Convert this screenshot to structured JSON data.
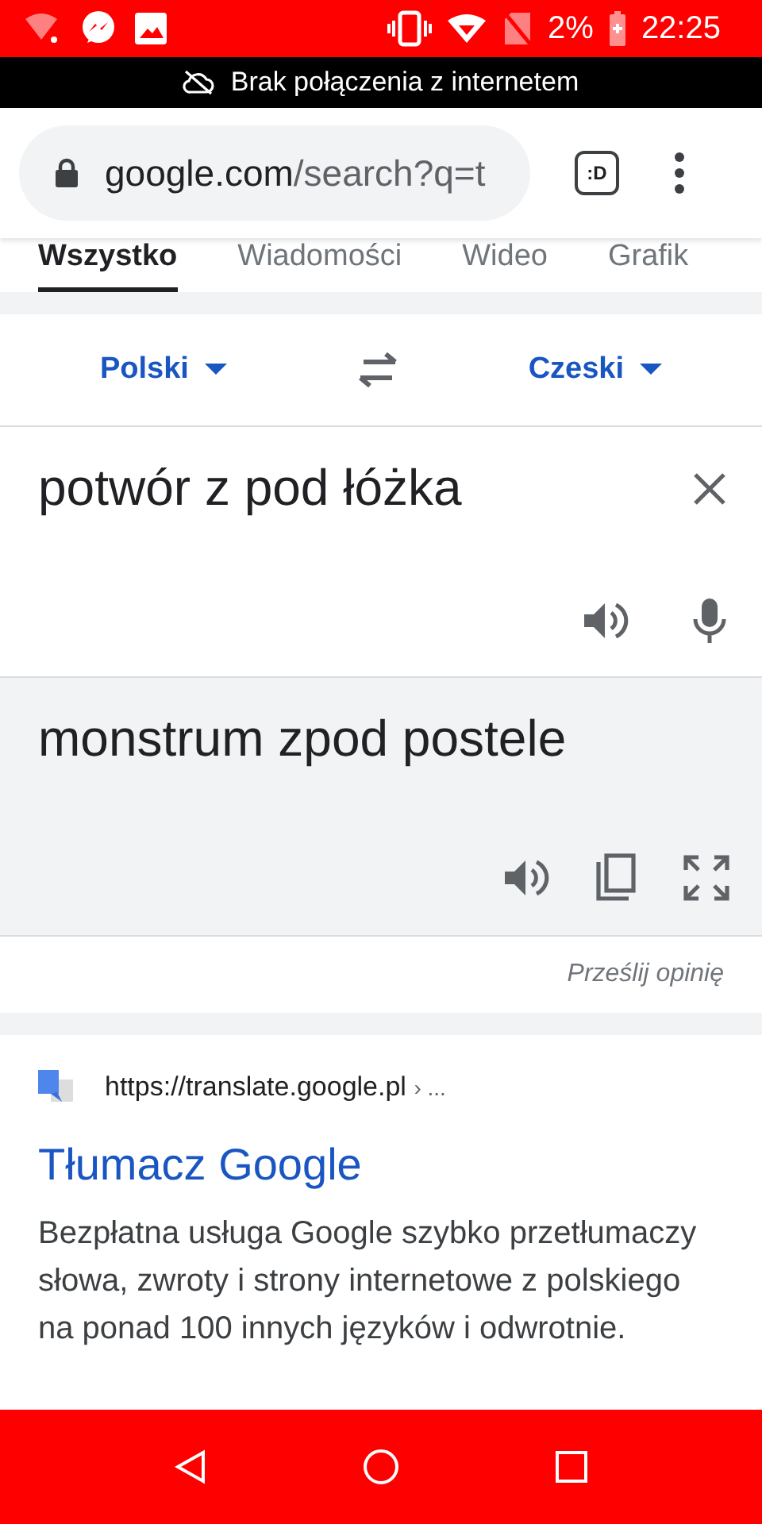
{
  "status_bar": {
    "battery_percent": "2%",
    "time": "22:25"
  },
  "offline_banner": {
    "text": "Brak połączenia z internetem"
  },
  "browser": {
    "url": "google.com/search?q=t",
    "mode_badge": ":D"
  },
  "tabs": [
    {
      "label": "Wszystko",
      "selected": true
    },
    {
      "label": "Wiadomości",
      "selected": false
    },
    {
      "label": "Wideo",
      "selected": false
    },
    {
      "label": "Grafik",
      "selected": false
    }
  ],
  "translator": {
    "source_language": "Polski",
    "target_language": "Czeski",
    "source_text": "potwór z pod łóżka",
    "translation": "monstrum zpod postele",
    "feedback": "Prześlij opinię"
  },
  "result": {
    "url": "https://translate.google.pl",
    "breadcrumb": "› ...",
    "title": "Tłumacz Google",
    "snippet": "Bezpłatna usługa Google szybko przetłumaczy słowa, zwroty i strony internetowe z polskiego na ponad 100 innych języków i odwrotnie."
  }
}
